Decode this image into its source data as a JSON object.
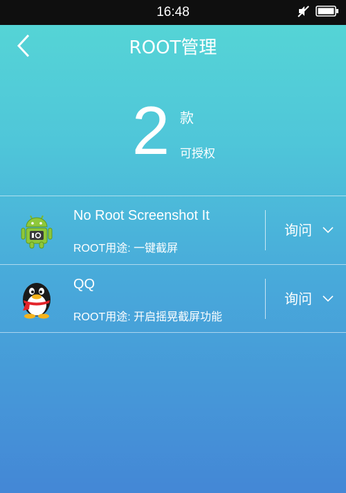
{
  "status_bar": {
    "time": "16:48",
    "icons": [
      "muted-icon",
      "battery-icon"
    ]
  },
  "nav": {
    "back_icon": "chevron-left-icon",
    "title": "ROOT管理"
  },
  "summary": {
    "count": "2",
    "unit": "款",
    "label": "可授权"
  },
  "apps": [
    {
      "name": "No Root Screenshot It",
      "purpose_prefix": "ROOT用途: ",
      "purpose": "一键截屏",
      "permission": "询问",
      "icon": "android-screenshot-icon"
    },
    {
      "name": "QQ",
      "purpose_prefix": "ROOT用途: ",
      "purpose": "开启摇晃截屏功能",
      "permission": "询问",
      "icon": "qq-penguin-icon"
    }
  ]
}
